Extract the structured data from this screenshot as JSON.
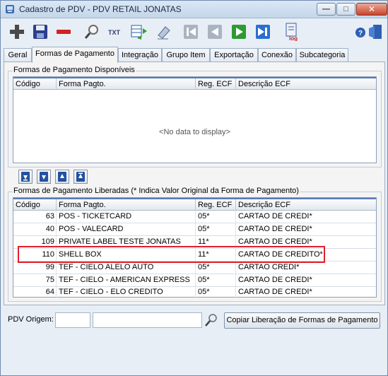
{
  "window": {
    "title": "Cadastro de PDV - PDV RETAIL JONATAS",
    "minimize_glyph": "—",
    "maximize_glyph": "□",
    "close_glyph": "✕"
  },
  "toolbar": {
    "txt_label": "TXT",
    "log_label": "log"
  },
  "tabs": [
    {
      "label": "Geral"
    },
    {
      "label": "Formas de Pagamento"
    },
    {
      "label": "Integração"
    },
    {
      "label": "Grupo Item"
    },
    {
      "label": "Exportação"
    },
    {
      "label": "Conexão"
    },
    {
      "label": "Subcategoria"
    }
  ],
  "disponiveis": {
    "group_label": "Formas de Pagamento Disponíveis",
    "columns": [
      "Código",
      "Forma Pagto.",
      "Reg. ECF",
      "Descrição ECF"
    ],
    "empty_text": "<No data to display>"
  },
  "liberadas": {
    "group_label": "Formas de Pagamento Liberadas (* Indica Valor Original da Forma de Pagamento)",
    "columns": [
      "Código",
      "Forma Pagto.",
      "Reg. ECF",
      "Descrição ECF"
    ],
    "rows": [
      {
        "codigo": "63",
        "forma": "POS - TICKETCARD",
        "reg": "05*",
        "desc": "CARTAO DE CREDI*"
      },
      {
        "codigo": "40",
        "forma": "POS - VALECARD",
        "reg": "05*",
        "desc": "CARTAO DE CREDI*"
      },
      {
        "codigo": "109",
        "forma": "PRIVATE LABEL TESTE JONATAS",
        "reg": "11*",
        "desc": "CARTAO DE CREDI*"
      },
      {
        "codigo": "110",
        "forma": "SHELL BOX",
        "reg": "11*",
        "desc": "CARTAO DE CREDITO*"
      },
      {
        "codigo": "99",
        "forma": "TEF - CIELO ALELO AUTO",
        "reg": "05*",
        "desc": "CARTAO CREDI*"
      },
      {
        "codigo": "75",
        "forma": "TEF - CIELO - AMERICAN EXPRESS",
        "reg": "05*",
        "desc": "CARTAO DE CREDI*"
      },
      {
        "codigo": "64",
        "forma": "TEF - CIELO - ELO CREDITO",
        "reg": "05*",
        "desc": "CARTAO DE CREDI*"
      }
    ]
  },
  "footer": {
    "origem_label": "PDV Origem:",
    "origem_code": "",
    "origem_name": "",
    "copy_button": "Copiar Liberação de Formas de Pagamento"
  },
  "colors": {
    "highlight": "#e0202a",
    "header_accent": "#5a7bb5",
    "window_bg": "#e8eef5"
  }
}
